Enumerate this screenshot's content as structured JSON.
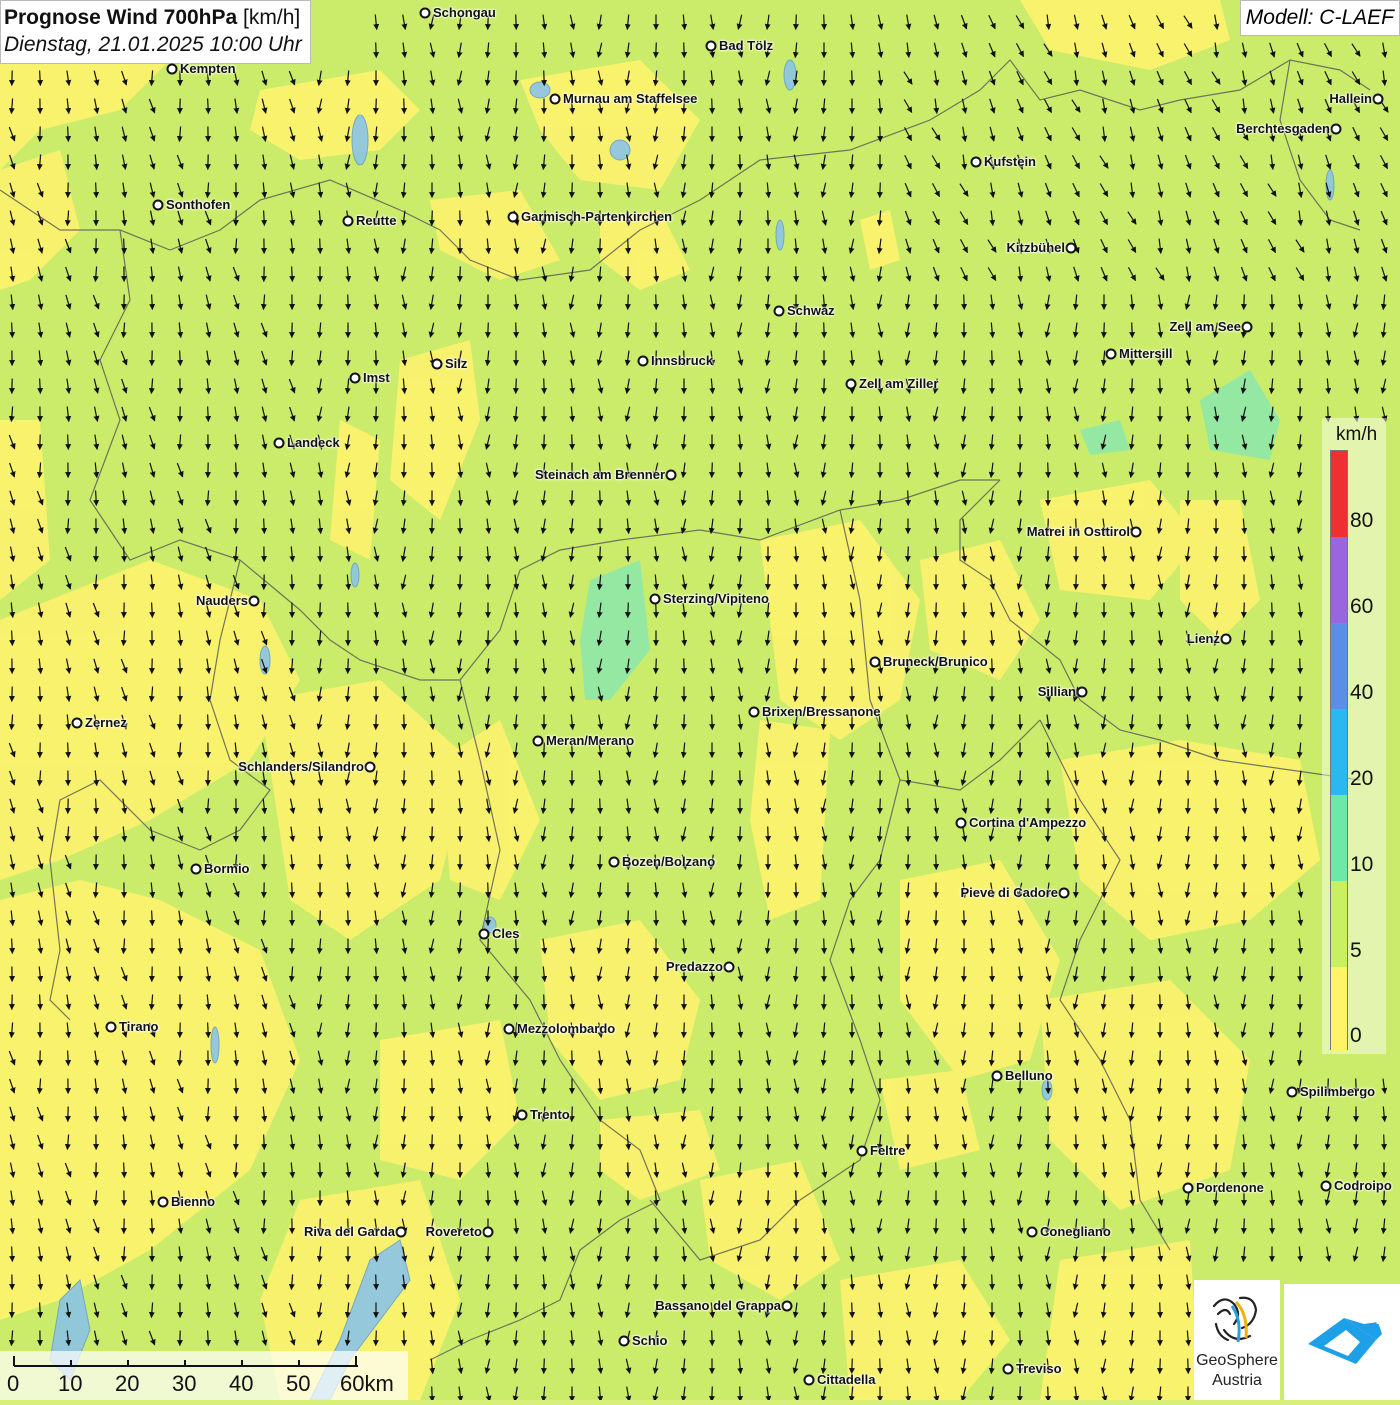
{
  "header": {
    "title_bold": "Prognose Wind 700hPa",
    "title_unit": "[km/h]",
    "datetime": "Dienstag, 21.01.2025 10:00 Uhr",
    "model": "Modell: C-LAEF"
  },
  "legend": {
    "unit": "km/h",
    "labels": [
      "80",
      "60",
      "40",
      "20",
      "10",
      "5",
      "0"
    ],
    "colors": [
      "#f03030",
      "#e84040",
      "#9966e0",
      "#5b8ee8",
      "#29b8f0",
      "#6de8a8",
      "#c8f060",
      "#fff468"
    ]
  },
  "scale": {
    "labels": [
      "0",
      "10",
      "20",
      "30",
      "40",
      "50",
      "60km"
    ]
  },
  "logo": {
    "line1": "GeoSphere",
    "line2": "Austria",
    "icon": "geosphere-logo-icon"
  },
  "app_icon": "cloud-arrow-app-icon",
  "wind_direction": "from north-northwest, arrows pointing south",
  "cities": [
    {
      "name": "Schongau"
    },
    {
      "name": "Bad Tölz"
    },
    {
      "name": "Kempten"
    },
    {
      "name": "Murnau am Staffelsee"
    },
    {
      "name": "Hallein"
    },
    {
      "name": "Berchtesgaden"
    },
    {
      "name": "Kufstein"
    },
    {
      "name": "Sonthofen"
    },
    {
      "name": "Reutte"
    },
    {
      "name": "Garmisch-Partenkirchen"
    },
    {
      "name": "Kitzbühel"
    },
    {
      "name": "Schwaz"
    },
    {
      "name": "Zell am See"
    },
    {
      "name": "Mittersill"
    },
    {
      "name": "Innsbruck"
    },
    {
      "name": "Silz"
    },
    {
      "name": "Imst"
    },
    {
      "name": "Zell am Ziller"
    },
    {
      "name": "Landeck"
    },
    {
      "name": "Steinach am Brenner"
    },
    {
      "name": "Matrei in Osttirol"
    },
    {
      "name": "Nauders"
    },
    {
      "name": "Sterzing/Vipiteno"
    },
    {
      "name": "Lienz"
    },
    {
      "name": "Bruneck/Brunico"
    },
    {
      "name": "Sillian"
    },
    {
      "name": "Zernez"
    },
    {
      "name": "Brixen/Bressanone"
    },
    {
      "name": "Meran/Merano"
    },
    {
      "name": "Schlanders/Silandro"
    },
    {
      "name": "Cortina d'Ampezzo"
    },
    {
      "name": "Bozen/Bolzano"
    },
    {
      "name": "Bormio"
    },
    {
      "name": "Pieve di Cadore"
    },
    {
      "name": "Cles"
    },
    {
      "name": "Predazzo"
    },
    {
      "name": "Tirano"
    },
    {
      "name": "Mezzolombardo"
    },
    {
      "name": "Belluno"
    },
    {
      "name": "Spilimbergo"
    },
    {
      "name": "Trento"
    },
    {
      "name": "Feltre"
    },
    {
      "name": "Pordenone"
    },
    {
      "name": "Codroipo"
    },
    {
      "name": "Bienno"
    },
    {
      "name": "Riva del Garda"
    },
    {
      "name": "Rovereto"
    },
    {
      "name": "Conegliano"
    },
    {
      "name": "Bassano del Grappa"
    },
    {
      "name": "Schio"
    },
    {
      "name": "Treviso"
    },
    {
      "name": "Cittadella"
    }
  ]
}
